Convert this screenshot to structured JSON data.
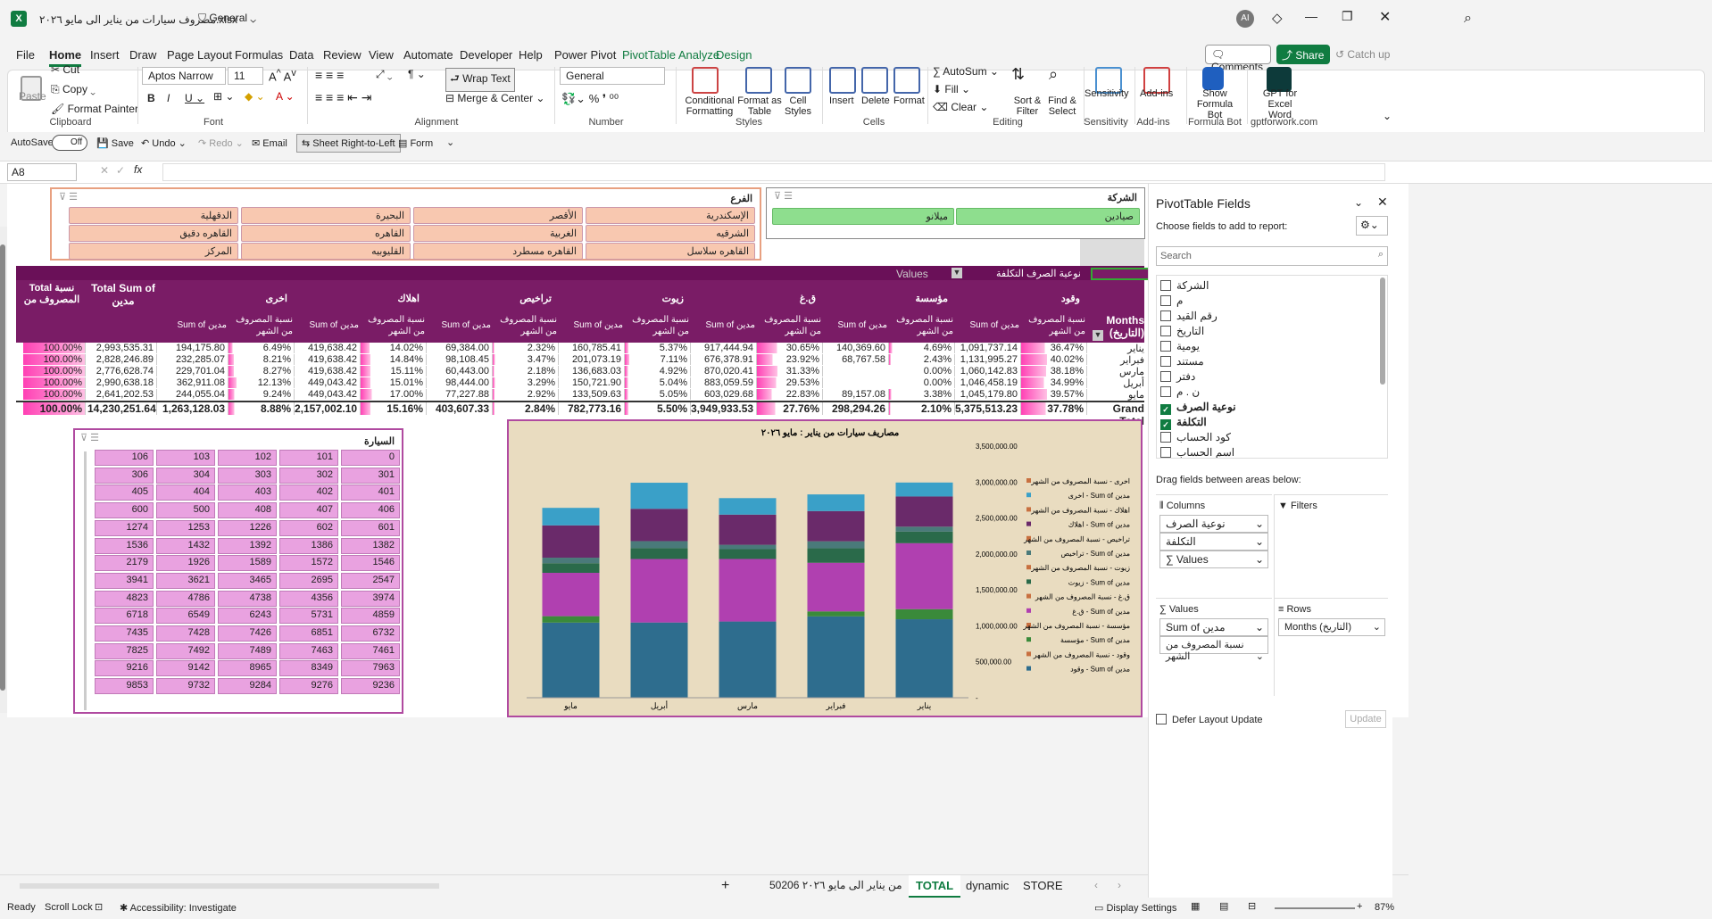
{
  "title": {
    "filename": "مصروف سيارات من يناير الى مايو ٢٠٢٦.xlsx",
    "sensitivity": "General",
    "user_initials": "AI"
  },
  "menu": [
    "File",
    "Home",
    "Insert",
    "Draw",
    "Page Layout",
    "Formulas",
    "Data",
    "Review",
    "View",
    "Automate",
    "Developer",
    "Help",
    "Power Pivot",
    "PivotTable Analyze",
    "Design"
  ],
  "share": {
    "comments": "Comments",
    "share": "Share",
    "catchup": "Catch up"
  },
  "ribbon": {
    "paste": "Paste",
    "cut": "Cut",
    "copy": "Copy",
    "format_painter": "Format Painter",
    "clipboard": "Clipboard",
    "font_name": "Aptos Narrow",
    "font_size": "11",
    "font": "Font",
    "wrap": "Wrap Text",
    "merge": "Merge & Center",
    "alignment": "Alignment",
    "number_format": "General",
    "number": "Number",
    "cond": "Conditional Formatting",
    "fmt_table": "Format as Table",
    "cell_styles": "Cell Styles",
    "styles": "Styles",
    "insert": "Insert",
    "delete": "Delete",
    "format": "Format",
    "cells": "Cells",
    "autosum": "AutoSum",
    "fill": "Fill",
    "clear": "Clear",
    "sort": "Sort & Filter",
    "find": "Find & Select",
    "editing": "Editing",
    "sensitivity": "Sensitivity",
    "addins": "Add-ins",
    "formula_bot": "Show Formula Bot",
    "formula_bot_grp": "Formula Bot",
    "gpt": "GPT for Excel Word",
    "gpt_grp": "gptforwork.com"
  },
  "qat": {
    "autosave": "AutoSave",
    "off": "Off",
    "save": "Save",
    "undo": "Undo",
    "redo": "Redo",
    "email": "Email",
    "rtl": "Sheet Right-to-Left",
    "form": "Form"
  },
  "namebox": "A8",
  "slicer_branch": {
    "title": "الفرع",
    "items": [
      [
        "الإسكندرية",
        "الأقصر",
        "البحيرة",
        "الدقهلية"
      ],
      [
        "الشرقيه",
        "الغربية",
        "القاهره",
        "القاهره دقيق"
      ],
      [
        "القاهره سلاسل",
        "القاهره مسطرد",
        "القليوبيه",
        "المركز"
      ]
    ]
  },
  "slicer_company": {
    "title": "الشركة",
    "items": [
      "صيادين",
      "ميلانو"
    ]
  },
  "pivot": {
    "values_label": "Values",
    "col_field": "نوعية الصرف",
    "col_field2": "التكلفة",
    "rows_label": "Months (التاريخ)",
    "total_pct": "Total نسبة المصروف من",
    "total_sum": "Total Sum of مدين",
    "groups": [
      "وقود",
      "مؤسسة",
      "ق.غ",
      "زيوت",
      "تراخيص",
      "اهلاك",
      "اخرى"
    ],
    "sub_pct": "نسبة المصروف من الشهر",
    "sub_sum": "Sum of مدين",
    "rows": [
      {
        "m": "يناير",
        "v": [
          "1,091,737.14",
          "36.47%",
          "140,369.60",
          "4.69%",
          "917,444.94",
          "30.65%",
          "160,785.41",
          "5.37%",
          "69,384.00",
          "2.32%",
          "419,638.42",
          "14.02%",
          "194,175.80",
          "6.49%",
          "2,993,535.31",
          "100.00%"
        ]
      },
      {
        "m": "فبراير",
        "v": [
          "1,131,995.27",
          "40.02%",
          "68,767.58",
          "2.43%",
          "676,378.91",
          "23.92%",
          "201,073.19",
          "7.11%",
          "98,108.45",
          "3.47%",
          "419,638.42",
          "14.84%",
          "232,285.07",
          "8.21%",
          "2,828,246.89",
          "100.00%"
        ]
      },
      {
        "m": "مارس",
        "v": [
          "1,060,142.83",
          "38.18%",
          "",
          "0.00%",
          "870,020.41",
          "31.33%",
          "136,683.03",
          "4.92%",
          "60,443.00",
          "2.18%",
          "419,638.42",
          "15.11%",
          "229,701.04",
          "8.27%",
          "2,776,628.74",
          "100.00%"
        ]
      },
      {
        "m": "أبريل",
        "v": [
          "1,046,458.19",
          "34.99%",
          "",
          "0.00%",
          "883,059.59",
          "29.53%",
          "150,721.90",
          "5.04%",
          "98,444.00",
          "3.29%",
          "449,043.42",
          "15.01%",
          "362,911.08",
          "12.13%",
          "2,990,638.18",
          "100.00%"
        ]
      },
      {
        "m": "مايو",
        "v": [
          "1,045,179.80",
          "39.57%",
          "89,157.08",
          "3.38%",
          "603,029.68",
          "22.83%",
          "133,509.63",
          "5.05%",
          "77,227.88",
          "2.92%",
          "449,043.42",
          "17.00%",
          "244,055.04",
          "9.24%",
          "2,641,202.53",
          "100.00%"
        ]
      }
    ],
    "grand": {
      "m": "Grand Total",
      "v": [
        "5,375,513.23",
        "37.78%",
        "298,294.26",
        "2.10%",
        "3,949,933.53",
        "27.76%",
        "782,773.16",
        "5.50%",
        "403,607.33",
        "2.84%",
        "2,157,002.10",
        "15.16%",
        "1,263,128.03",
        "8.88%",
        "14,230,251.64",
        "100.00%"
      ]
    }
  },
  "slicer_car": {
    "title": "السيارة",
    "items": [
      [
        "0",
        "101",
        "102",
        "103",
        "106"
      ],
      [
        "301",
        "302",
        "303",
        "304",
        "306"
      ],
      [
        "401",
        "402",
        "403",
        "404",
        "405"
      ],
      [
        "406",
        "407",
        "408",
        "500",
        "600"
      ],
      [
        "601",
        "602",
        "1226",
        "1253",
        "1274"
      ],
      [
        "1382",
        "1386",
        "1392",
        "1432",
        "1536"
      ],
      [
        "1546",
        "1572",
        "1589",
        "1926",
        "2179"
      ],
      [
        "2547",
        "2695",
        "3465",
        "3621",
        "3941"
      ],
      [
        "3974",
        "4356",
        "4738",
        "4786",
        "4823"
      ],
      [
        "4859",
        "5731",
        "6243",
        "6549",
        "6718"
      ],
      [
        "6732",
        "6851",
        "7426",
        "7428",
        "7435"
      ],
      [
        "7461",
        "7463",
        "7489",
        "7492",
        "7825"
      ],
      [
        "7963",
        "8349",
        "8965",
        "9142",
        "9216"
      ],
      [
        "9236",
        "9276",
        "9284",
        "9732",
        "9853"
      ]
    ]
  },
  "chart_data": {
    "type": "bar",
    "stacked": true,
    "title": "مصاريف سيارات من يناير : مايو ٢٠٢٦",
    "categories": [
      "يناير",
      "فبراير",
      "مارس",
      "أبريل",
      "مايو"
    ],
    "ylim": [
      0,
      3500000
    ],
    "yticks": [
      "3,500,000.00",
      "3,000,000.00",
      "2,500,000.00",
      "2,000,000.00",
      "1,500,000.00",
      "1,000,000.00",
      "500,000.00",
      "-"
    ],
    "series": [
      {
        "name": "وقود - Sum of مدين",
        "values": [
          1091737.14,
          1131995.27,
          1060142.83,
          1046458.19,
          1045179.8
        ],
        "color": "#2e6d8e"
      },
      {
        "name": "مؤسسة - Sum of مدين",
        "values": [
          140369.6,
          68767.58,
          0,
          0,
          89157.08
        ],
        "color": "#3a8a3a"
      },
      {
        "name": "ق.غ - Sum of مدين",
        "values": [
          917444.94,
          676378.91,
          870020.41,
          883059.59,
          603029.68
        ],
        "color": "#b040b0"
      },
      {
        "name": "زيوت - Sum of مدين",
        "values": [
          160785.41,
          201073.19,
          136683.03,
          150721.9,
          133509.63
        ],
        "color": "#2a6a4a"
      },
      {
        "name": "تراخيص - Sum of مدين",
        "values": [
          69384.0,
          98108.45,
          60443.0,
          98444.0,
          77227.88
        ],
        "color": "#4a7a7a"
      },
      {
        "name": "اهلاك - Sum of مدين",
        "values": [
          419638.42,
          419638.42,
          419638.42,
          449043.42,
          449043.42
        ],
        "color": "#6a2a6a"
      },
      {
        "name": "اخرى - Sum of مدين",
        "values": [
          194175.8,
          232285.07,
          229701.04,
          362911.08,
          244055.04
        ],
        "color": "#3aa0c8"
      }
    ],
    "legend": [
      "اخرى - نسبة المصروف من الشهر",
      "اخرى - Sum of مدين",
      "اهلاك - نسبة المصروف من الشهر",
      "اهلاك - Sum of مدين",
      "تراخيص - نسبة المصروف من الشهر",
      "تراخيص - Sum of مدين",
      "زيوت - نسبة المصروف من الشهر",
      "زيوت - Sum of مدين",
      "ق.غ - نسبة المصروف من الشهر",
      "ق.غ - Sum of مدين",
      "مؤسسة - نسبة المصروف من الشهر",
      "مؤسسة - Sum of مدين",
      "وقود - نسبة المصروف من الشهر",
      "وقود - Sum of مدين"
    ],
    "legend_colors": [
      "#c87040",
      "#3aa0c8",
      "#c87040",
      "#6a2a6a",
      "#c87040",
      "#4a7a7a",
      "#c87040",
      "#2a6a4a",
      "#c87040",
      "#b040b0",
      "#c87040",
      "#3a8a3a",
      "#c87040",
      "#2e6d8e"
    ]
  },
  "pane": {
    "title": "PivotTable Fields",
    "choose": "Choose fields to add to report:",
    "search": "Search",
    "fields": [
      {
        "n": "الشركة",
        "c": false
      },
      {
        "n": "م",
        "c": false
      },
      {
        "n": "رقم القيد",
        "c": false
      },
      {
        "n": "التاريخ",
        "c": false
      },
      {
        "n": "يومية",
        "c": false
      },
      {
        "n": "مستند",
        "c": false
      },
      {
        "n": "دفتر",
        "c": false
      },
      {
        "n": "ن . م",
        "c": false
      },
      {
        "n": "نوعية الصرف",
        "c": true
      },
      {
        "n": "التكلفة",
        "c": true
      },
      {
        "n": "كود الحساب",
        "c": false
      },
      {
        "n": "اسم الحساب",
        "c": false
      }
    ],
    "drag": "Drag fields between areas below:",
    "columns": "Columns",
    "filters": "Filters",
    "values": "Values",
    "rows": "Rows",
    "col_items": [
      "نوعية الصرف",
      "التكلفة",
      "Values"
    ],
    "val_items": [
      "Sum of مدين",
      "نسبة المصروف من الشهر"
    ],
    "row_items": [
      "Months (التاريخ)"
    ],
    "defer": "Defer Layout Update",
    "update": "Update"
  },
  "tabs": [
    "من يناير الى مايو ٢٠٢٦ 50206",
    "TOTAL",
    "dynamic",
    "STORE"
  ],
  "status": {
    "ready": "Ready",
    "scroll": "Scroll Lock",
    "access": "Accessibility: Investigate",
    "display": "Display Settings",
    "zoom": "87%"
  }
}
